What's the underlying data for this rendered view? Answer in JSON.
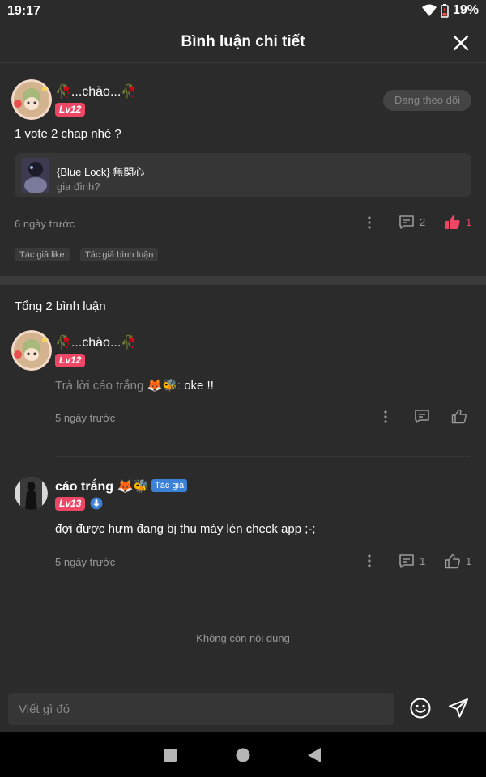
{
  "status": {
    "time": "19:17",
    "battery": "19%"
  },
  "header": {
    "title": "Bình luận chi tiết"
  },
  "post": {
    "user": {
      "name": "🥀...chào...🥀",
      "level": "Lv12"
    },
    "follow_label": "Đang theo dõi",
    "content": "1 vote 2 chap nhé ?",
    "quote": {
      "title": "{Blue Lock} 無関心",
      "subtitle": "gia đình?"
    },
    "time": "6 ngày trước",
    "comment_count": "2",
    "like_count": "1",
    "tags": [
      "Tác giả like",
      "Tác giả bình luận"
    ]
  },
  "total_label": "Tổng 2 bình luận",
  "comments": [
    {
      "name": "🥀...chào...🥀",
      "level": "Lv12",
      "reply_prefix": "Trả lời cáo trắng 🦊🐝:",
      "reply_text": "oke !!",
      "time": "5 ngày trước"
    },
    {
      "name": "cáo trắng 🦊🐝",
      "author_badge": "Tác giả",
      "level": "Lv13",
      "text": "đợi được hưm đang bị thu máy lén check app ;-;",
      "time": "5 ngày trước",
      "comment_count": "1",
      "like_count": "1"
    }
  ],
  "end_label": "Không còn nội dung",
  "input": {
    "placeholder": "Viết gì đó"
  },
  "colors": {
    "accent": "#ee4766",
    "author": "#3b82d6",
    "background": "#2b2b2b"
  }
}
